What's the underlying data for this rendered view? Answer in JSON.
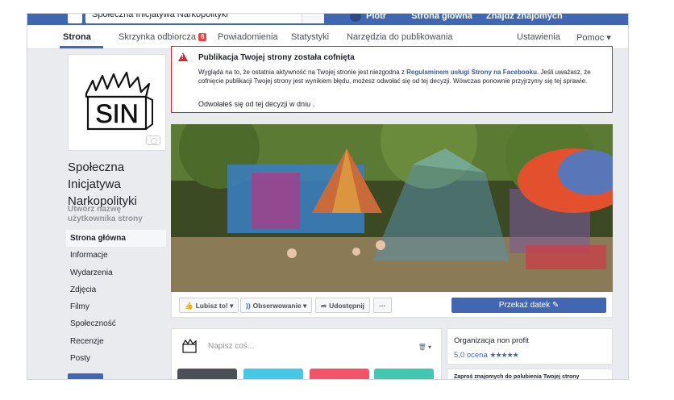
{
  "topbar": {
    "search_text": "Społeczna Inicjatywa Narkopolityki",
    "links": [
      "Piotr",
      "Strona główna",
      "Znajdź znajomych"
    ]
  },
  "pagenav": {
    "items": [
      {
        "label": "Strona",
        "active": true
      },
      {
        "label": "Skrzynka odbiorcza",
        "badge": "6"
      },
      {
        "label": "Powiadomienia"
      },
      {
        "label": "Statystyki"
      },
      {
        "label": "Narzędzia do publikowania"
      }
    ],
    "settings": "Ustawienia",
    "help": "Pomoc ▾"
  },
  "page": {
    "name": "Społeczna Inicjatywa Narkopolityki",
    "username_link": "Utwórz nazwę użytkownika strony",
    "logo_text": "SIN"
  },
  "leftnav": [
    "Strona główna",
    "Informacje",
    "Wydarzenia",
    "Zdjęcia",
    "Filmy",
    "Społeczność",
    "Recenzje",
    "Posty"
  ],
  "alert": {
    "title": "Publikacja Twojej strony została cofnięta",
    "body_pre": "Wygląda na to, że ostatnia aktywność na Twojej stronie jest niezgodna z ",
    "body_link": "Regulaminem usługi Strony na Facebooku",
    "body_post": ". Jeśli uważasz, że cofnięcie publikacji Twojej strony jest wynikiem błędu, możesz odwołać się od tej decyzji. Wówczas ponownie przyjrzymy się tej sprawie.",
    "footer": "Odwołałeś się od tej decyzji w dniu ."
  },
  "actions": {
    "like": "Lubisz to! ▾",
    "follow": "Obserwowanie ▾",
    "share": "Udostępnij",
    "more": "···",
    "donate": "Przekaż datek ✎"
  },
  "composer": {
    "placeholder": "Napisz coś...",
    "menu": "▾"
  },
  "info": {
    "category": "Organizacja non profit",
    "rating": "5,0 ocena",
    "stars": "★★★★★",
    "invite": "Zaproś znajomych do polubienia Twojej strony"
  },
  "colors": {
    "brand": "#4267b2",
    "alert": "#e0212e",
    "background": "#e9ebee"
  }
}
